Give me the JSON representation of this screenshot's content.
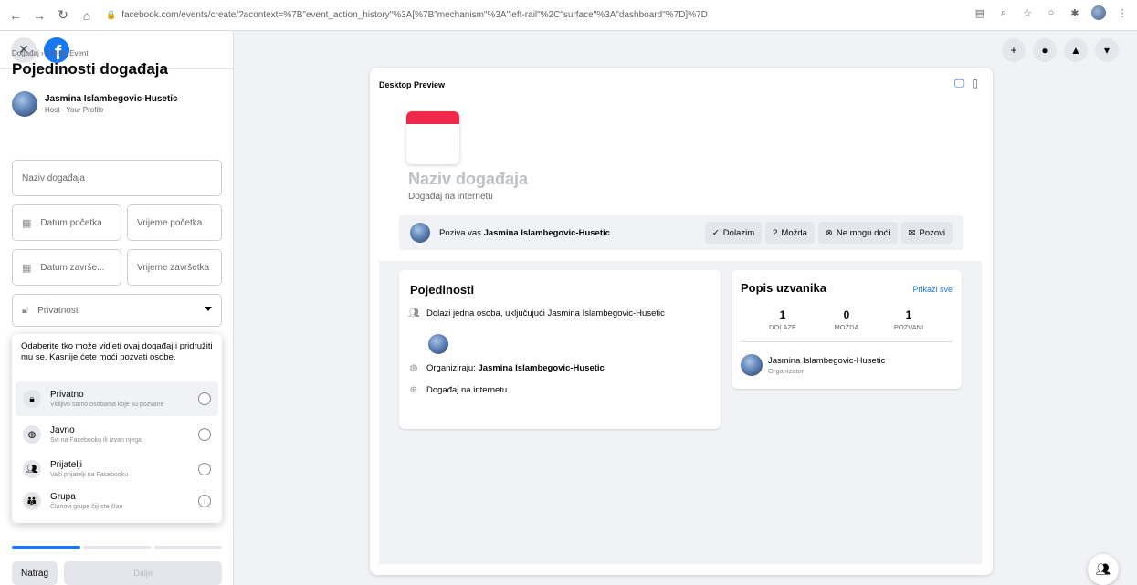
{
  "browser": {
    "url": "facebook.com/events/create/?acontext=%7B\"event_action_history\"%3A[%7B\"mechanism\"%3A\"left-rail\"%2C\"surface\"%3A\"dashboard\"%7D]%7D"
  },
  "sidebar": {
    "breadcrumb": "Događaj › Create Event",
    "title": "Pojedinosti događaja",
    "host_name": "Jasmina Islambegovic-Husetic",
    "host_sub": "Host · Your Profile",
    "name_placeholder": "Naziv događaja",
    "start_date_placeholder": "Datum početka",
    "start_time_placeholder": "Vrijeme početka",
    "end_date_placeholder": "Datum završe...",
    "end_time_placeholder": "Vrijeme završetka",
    "privacy_placeholder": "Privatnost",
    "privacy_help": "Odaberite tko može vidjeti ovaj događaj i pridružiti mu se. Kasnije ćete moći pozvati osobe.",
    "privacy_options": [
      {
        "title": "Privatno",
        "subtitle": "Vidljivo samo osobama koje su pozvane"
      },
      {
        "title": "Javno",
        "subtitle": "Svi na Facebooku ili izvan njega"
      },
      {
        "title": "Prijatelji",
        "subtitle": "Vaši prijatelji na Facebooku"
      },
      {
        "title": "Grupa",
        "subtitle": "Članovi grupe čiji ste član"
      }
    ],
    "progress_steps_done": 1,
    "progress_steps_total": 3,
    "back_label": "Natrag",
    "next_label": "Dalje"
  },
  "preview": {
    "label": "Desktop Preview",
    "event_name": "Naziv događaja",
    "event_type": "Događaj na internetu",
    "invite_prefix": "Poziva vas ",
    "invite_name": "Jasmina Islambegovic-Husetic",
    "rsvp_going": "Dolazim",
    "rsvp_maybe": "Možda",
    "rsvp_cant": "Ne mogu doći",
    "rsvp_invite": "Pozovi",
    "details": {
      "title": "Pojedinosti",
      "attending": "Dolazi jedna osoba, uključujući Jasmina Islambegovic-Husetic",
      "organized_prefix": "Organiziraju: ",
      "organized_name": "Jasmina Islambegovic-Husetic",
      "online": "Događaj na internetu"
    },
    "guests": {
      "title": "Popis uzvanika",
      "show_all": "Prikaži sve",
      "going_count": "1",
      "going_label": "DOLAZE",
      "maybe_count": "0",
      "maybe_label": "MOŽDA",
      "invited_count": "1",
      "invited_label": "POZVANI",
      "person_name": "Jasmina Islambegovic-Husetic",
      "person_role": "Organizator"
    }
  },
  "colors": {
    "brand": "#1877f2",
    "calendar_red": "#f02849"
  }
}
